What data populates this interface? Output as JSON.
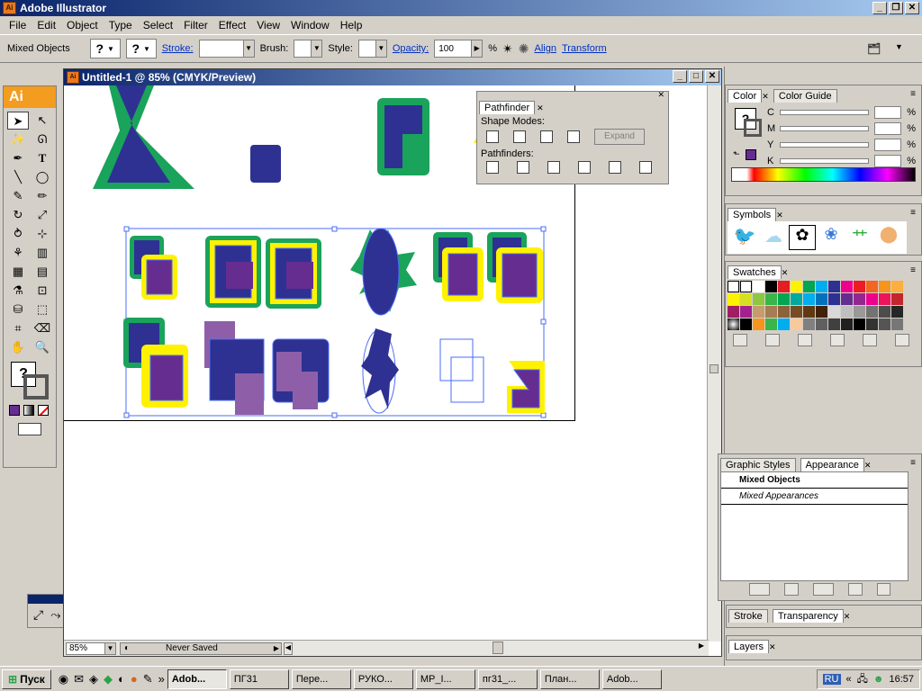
{
  "app": {
    "title": "Adobe Illustrator",
    "icon": "Ai"
  },
  "menu": [
    "File",
    "Edit",
    "Object",
    "Type",
    "Select",
    "Filter",
    "Effect",
    "View",
    "Window",
    "Help"
  ],
  "control_bar": {
    "selection_label": "Mixed Objects",
    "stroke_label": "Stroke:",
    "brush_label": "Brush:",
    "style_label": "Style:",
    "opacity_label": "Opacity:",
    "opacity_value": "100",
    "percent": "%",
    "align_label": "Align",
    "transform_label": "Transform",
    "unknown_glyph": "?"
  },
  "tools_panel": {
    "logo": "Ai",
    "unknown_glyph": "?"
  },
  "document": {
    "title": "Untitled-1 @ 85% (CMYK/Preview)",
    "zoom": "85%",
    "status": "Never Saved"
  },
  "pathfinder": {
    "tab": "Pathfinder",
    "shape_modes_label": "Shape Modes:",
    "pathfinders_label": "Pathfinders:",
    "expand_label": "Expand"
  },
  "color_panel": {
    "tabs": [
      "Color",
      "Color Guide"
    ],
    "channels": [
      "C",
      "M",
      "Y",
      "K"
    ],
    "percent": "%"
  },
  "symbols_panel": {
    "tab": "Symbols"
  },
  "swatches_panel": {
    "tab": "Swatches"
  },
  "appearance_panel": {
    "tabs": [
      "Graphic Styles",
      "Appearance"
    ],
    "title": "Mixed Objects",
    "row": "Mixed Appearances"
  },
  "stroke_panel": {
    "tabs": [
      "Stroke",
      "Transparency"
    ]
  },
  "layers_panel": {
    "tab": "Layers"
  },
  "taskbar": {
    "start": "Пуск",
    "items": [
      "Adob...",
      "ПГ31",
      "Пере...",
      "РУКО...",
      "МР_I...",
      "пг31_...",
      "План...",
      "Adob..."
    ],
    "lang": "RU",
    "time": "16:57"
  },
  "colors": {
    "green": "#1aa35a",
    "navy": "#2e3192",
    "purple": "#662d91",
    "yellow": "#fff200",
    "selection": "#4a6cf7"
  }
}
